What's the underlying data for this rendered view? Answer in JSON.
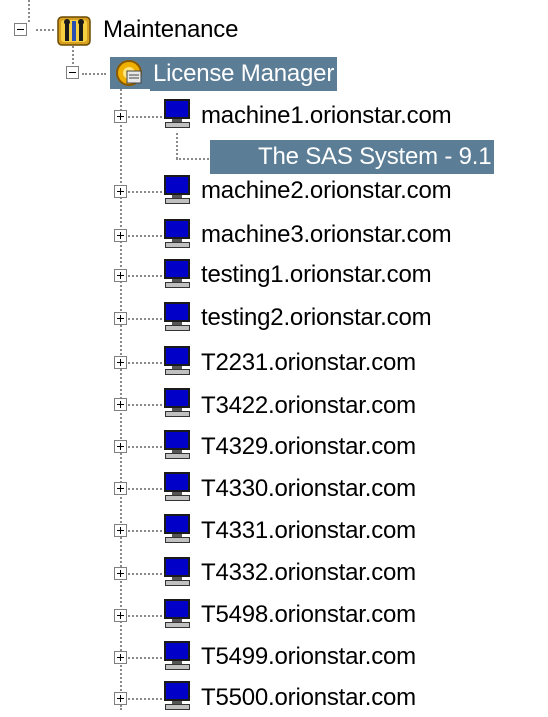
{
  "tree": {
    "root": {
      "label": "Maintenance",
      "icon": "maintenance-tools-icon",
      "expanded": true,
      "children": [
        {
          "label": "License Manager",
          "icon": "license-manager-icon",
          "expanded": true,
          "selected": true,
          "children": [
            {
              "label": "machine1.orionstar.com",
              "icon": "computer-icon",
              "expanded": true,
              "children": [
                {
                  "label": "The SAS System - 9.1",
                  "icon": "sas-system-icon",
                  "selected": true
                }
              ]
            },
            {
              "label": "machine2.orionstar.com",
              "icon": "computer-icon",
              "expanded": false
            },
            {
              "label": "machine3.orionstar.com",
              "icon": "computer-icon",
              "expanded": false
            },
            {
              "label": "testing1.orionstar.com",
              "icon": "computer-icon",
              "expanded": false
            },
            {
              "label": "testing2.orionstar.com",
              "icon": "computer-icon",
              "expanded": false
            },
            {
              "label": "T2231.orionstar.com",
              "icon": "computer-icon",
              "expanded": false
            },
            {
              "label": "T3422.orionstar.com",
              "icon": "computer-icon",
              "expanded": false
            },
            {
              "label": "T4329.orionstar.com",
              "icon": "computer-icon",
              "expanded": false
            },
            {
              "label": "T4330.orionstar.com",
              "icon": "computer-icon",
              "expanded": false
            },
            {
              "label": "T4331.orionstar.com",
              "icon": "computer-icon",
              "expanded": false
            },
            {
              "label": "T4332.orionstar.com",
              "icon": "computer-icon",
              "expanded": false
            },
            {
              "label": "T5498.orionstar.com",
              "icon": "computer-icon",
              "expanded": false
            },
            {
              "label": "T5499.orionstar.com",
              "icon": "computer-icon",
              "expanded": false
            },
            {
              "label": "T5500.orionstar.com",
              "icon": "computer-icon",
              "expanded": false
            }
          ]
        }
      ]
    }
  },
  "colors": {
    "selection_bg": "#5b7d96",
    "selection_text": "#ffffff",
    "computer_screen": "#0000c8",
    "tree_lines": "#8a8a8a"
  }
}
